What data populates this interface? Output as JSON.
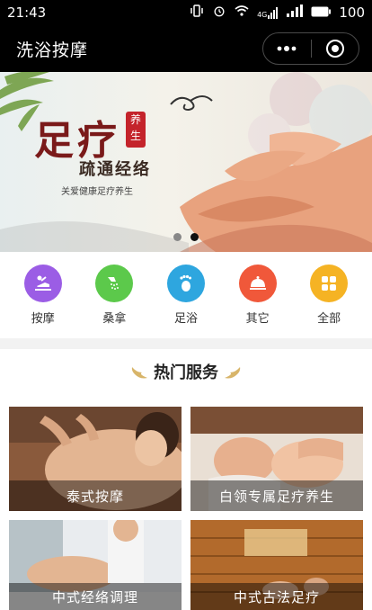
{
  "status_bar": {
    "time": "21:43",
    "network": "4G",
    "battery": "100"
  },
  "nav": {
    "title": "洗浴按摩"
  },
  "banner": {
    "headline": "足疗",
    "tag": "养生",
    "subtitle": "疏通经络",
    "caption": "关爱健康足疗养生",
    "slide_count": 2,
    "active_slide": 2
  },
  "categories": [
    {
      "label": "按摩",
      "icon": "massage-icon",
      "color": "#9b5de5"
    },
    {
      "label": "桑拿",
      "icon": "sauna-shower-icon",
      "color": "#5cc94b"
    },
    {
      "label": "足浴",
      "icon": "foot-icon",
      "color": "#2ea6df"
    },
    {
      "label": "其它",
      "icon": "food-cover-icon",
      "color": "#f0583a"
    },
    {
      "label": "全部",
      "icon": "grid-icon",
      "color": "#f5b324"
    }
  ],
  "hot_services": {
    "title": "热门服务",
    "items": [
      {
        "label": "泰式按摩"
      },
      {
        "label": "白领专属足疗养生"
      },
      {
        "label": "中式经络调理"
      },
      {
        "label": "中式古法足疗"
      }
    ]
  }
}
